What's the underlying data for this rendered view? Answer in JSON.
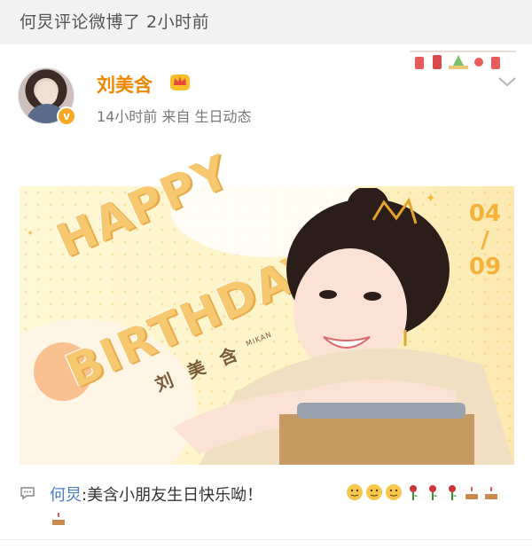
{
  "notification": {
    "text": "何炅评论微博了 2小时前"
  },
  "post": {
    "author": "刘美含",
    "verified": true,
    "meta": "14小时前  来自 生日动态",
    "banner": {
      "happy": "HAPPY",
      "birthday": "BIRTHDAY",
      "name": "刘 美 含",
      "mikan": "MIKAN",
      "date_month": "04",
      "date_sep": "/",
      "date_day": "09"
    }
  },
  "comment": {
    "author": "何炅",
    "text": ":美含小朋友生日快乐呦！"
  },
  "icons": [
    "comment-icon",
    "crown-icon",
    "chevron-down-icon",
    "blush-emoji",
    "rose-emoji",
    "cake-emoji"
  ],
  "colors": {
    "author": "#f08500",
    "commenter": "#4b7cc8",
    "accent": "#f6c870"
  }
}
